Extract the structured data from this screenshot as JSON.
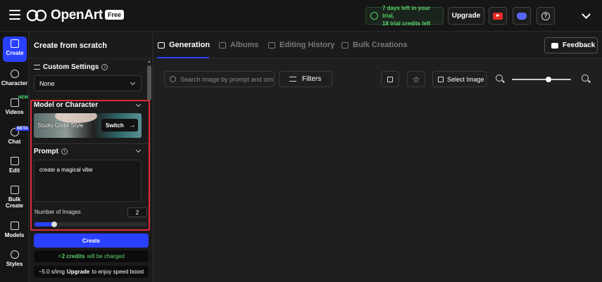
{
  "app": {
    "name": "OpenArt",
    "plan_badge": "Free"
  },
  "header": {
    "trial_text_line1": "7 days left in your trial,",
    "trial_text_line2": "18 trial credits left",
    "upgrade_label": "Upgrade",
    "icons": [
      "youtube-icon",
      "discord-icon",
      "help-icon",
      "chevron-down-icon"
    ]
  },
  "nav": {
    "items": [
      {
        "label": "Create",
        "active": true
      },
      {
        "label": "Character"
      },
      {
        "label": "Videos",
        "badge": "NEW"
      },
      {
        "label": "Chat",
        "badge": "BETA"
      },
      {
        "label": "Edit"
      },
      {
        "label": "Bulk Create"
      },
      {
        "label": "Models"
      },
      {
        "label": "Styles"
      }
    ]
  },
  "panel": {
    "title": "Create from scratch",
    "custom_settings_label": "Custom Settings",
    "custom_settings_value": "None",
    "model_section_title": "Model or Character",
    "model_name": "Studio Ghibli Style",
    "switch_label": "Switch",
    "prompt_title": "Prompt",
    "prompt_value": "create a magical vibe",
    "num_images_label": "Number of Images",
    "num_images_value": "2",
    "num_images_slider_fraction": 0.15,
    "create_label": "Create",
    "credits_strong": "2 credits",
    "credits_rest": "will be charged",
    "speed_prefix": "~5.0 s/img",
    "speed_upgrade": "Upgrade",
    "speed_suffix": "to enjoy speed boost"
  },
  "main": {
    "tabs": [
      {
        "label": "Generation",
        "active": true
      },
      {
        "label": "Albums"
      },
      {
        "label": "Editing History"
      },
      {
        "label": "Bulk Creations"
      }
    ],
    "feedback_label": "Feedback",
    "search_placeholder": "Search image by prompt and sim",
    "filters_label": "Filters",
    "select_image_label": "Select Image",
    "zoom_fraction": 0.62
  },
  "colors": {
    "accent": "#2a40ff",
    "highlight": "#e02b3a",
    "trial_green": "#5bd36b"
  }
}
